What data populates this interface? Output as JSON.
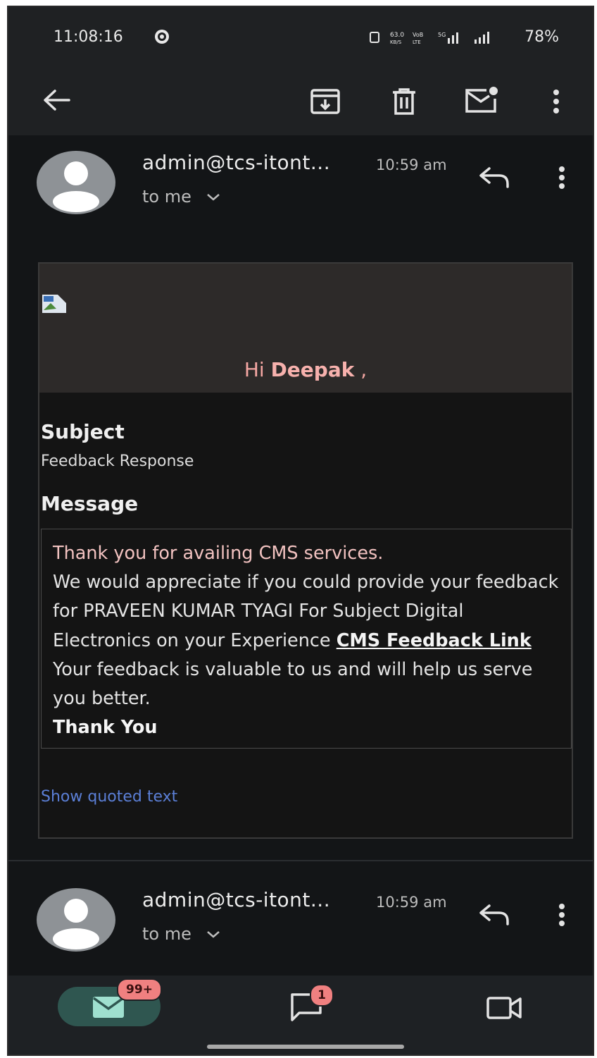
{
  "status_bar": {
    "time": "11:08:16",
    "indicators": "63.0 KB/s  VoLTE  5G  78%",
    "battery": "78%"
  },
  "toolbar": {
    "back_icon": "arrow-left-icon",
    "archive_icon": "archive-icon",
    "delete_icon": "trash-icon",
    "unread_icon": "mark-unread-icon",
    "more_icon": "more-vertical-icon"
  },
  "messages": [
    {
      "sender": "admin@tcs-itont...",
      "time": "10:59 am",
      "recipient": "to me"
    },
    {
      "sender": "admin@tcs-itont...",
      "time": "10:59 am",
      "recipient": "to me"
    }
  ],
  "email_body": {
    "greeting_prefix": "Hi ",
    "greeting_name": "Deepak",
    "greeting_suffix": " ,",
    "subject_label": "Subject",
    "subject_value": "Feedback Response",
    "message_label": "Message",
    "line1": "Thank you for availing CMS services.",
    "line2": "We would appreciate if you could provide your feedback for PRAVEEN KUMAR TYAGI For Subject Digital Electronics on your Experience ",
    "link_text": "CMS Feedback Link",
    "line3": " Your feedback is valuable to us and will help us serve you better.",
    "thanks": "Thank You",
    "show_quoted": "Show quoted text"
  },
  "bottom_nav": {
    "mail_badge": "99+",
    "chat_badge": "1"
  },
  "colors": {
    "background": "#131517",
    "greeting": "#f5a7a3",
    "link_blue": "#5b7fd6",
    "badge": "#f08080",
    "mail_pill": "#2f5650"
  }
}
